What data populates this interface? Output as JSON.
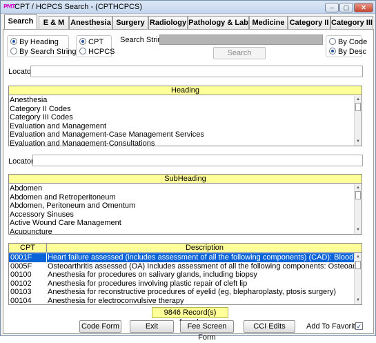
{
  "window": {
    "title": "CPT / HCPCS Search - (CPTHCPCS)",
    "icon_text": "PMT",
    "buttons": [
      "–",
      "▢",
      "✕"
    ]
  },
  "tabs": [
    {
      "label": "Search",
      "active": true
    },
    {
      "label": "E & M"
    },
    {
      "label": "Anesthesia"
    },
    {
      "label": "Surgery"
    },
    {
      "label": "Radiology"
    },
    {
      "label": "Pathology & Lab"
    },
    {
      "label": "Medicine"
    },
    {
      "label": "Category II"
    },
    {
      "label": "Category III"
    }
  ],
  "search": {
    "search_mode": {
      "by_heading": "By Heading",
      "by_search_string": "By Search String",
      "selected": "By Heading"
    },
    "code_type": {
      "cpt": "CPT",
      "hcpcs": "HCPCS",
      "selected": "CPT"
    },
    "sort": {
      "by_code": "By Code",
      "by_desc": "By Desc",
      "selected": "By Desc"
    },
    "search_string_label": "Search String",
    "search_string_value": "",
    "search_button": "Search"
  },
  "locator1": {
    "label": "Locator",
    "value": ""
  },
  "heading_list": {
    "header": "Heading",
    "items": [
      "Anesthesia",
      "Category II Codes",
      "Category III Codes",
      "Evaluation and Management",
      "Evaluation and Management-Case Management Services",
      "Evaluation and Management-Consultations"
    ]
  },
  "locator2": {
    "label": "Locator",
    "value": ""
  },
  "subheading_list": {
    "header": "SubHeading",
    "items": [
      "Abdomen",
      "Abdomen and Retroperitoneum",
      "Abdomen, Peritoneum and Omentum",
      "Accessory Sinuses",
      "Active Wound Care Management",
      "Acupuncture"
    ]
  },
  "code_table": {
    "columns": [
      "CPT",
      "Description"
    ],
    "rows": [
      {
        "code": "0001F",
        "desc": "Heart failure assessed (includes assessment of all the following components) (CAD): Blood pressure measu",
        "selected": true
      },
      {
        "code": "0005F",
        "desc": "Osteoarthritis assessed (OA) Includes assessment of all the following components: Osteoarthritis symptoms a"
      },
      {
        "code": "00100",
        "desc": "Anesthesia for procedures on salivary glands, including biopsy"
      },
      {
        "code": "00102",
        "desc": "Anesthesia for procedures involving plastic repair of cleft lip"
      },
      {
        "code": "00103",
        "desc": "Anesthesia for reconstructive procedures of eyelid (eg, blepharoplasty, ptosis surgery)"
      },
      {
        "code": "00104",
        "desc": "Anesthesia for electroconvulsive therapy"
      }
    ]
  },
  "records_found": "9846 Record(s) found.",
  "footer": {
    "code_form": "Code Form",
    "exit": "Exit",
    "fee_screen_form": "Fee Screen Form",
    "cci_edits": "CCI Edits",
    "add_to_favorites": "Add To Favorites",
    "add_to_favorites_checked": true
  }
}
